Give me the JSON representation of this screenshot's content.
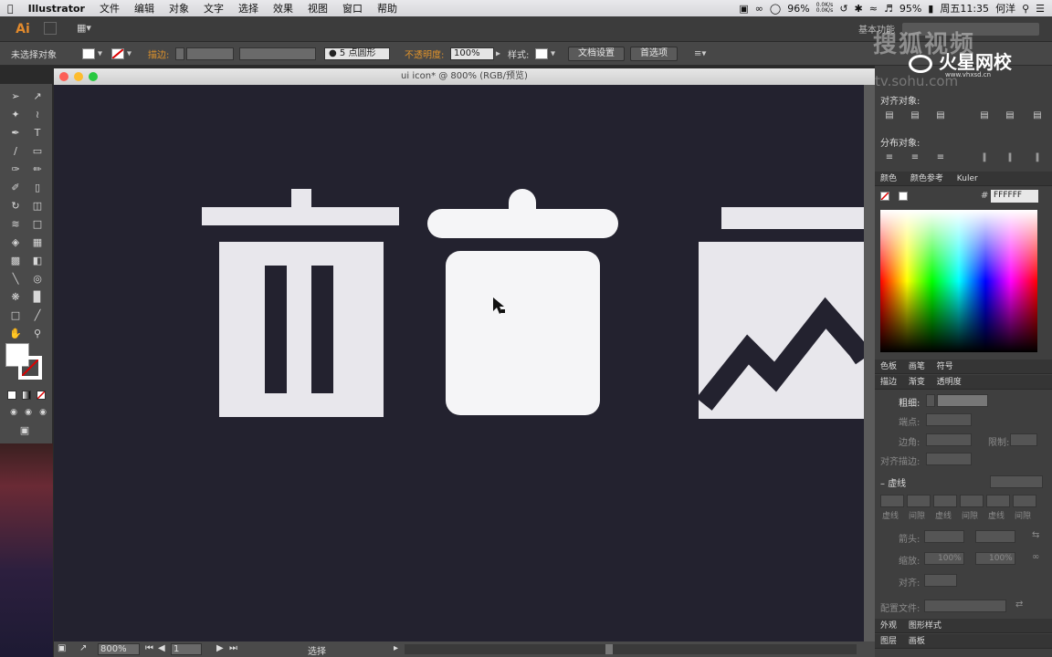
{
  "menubar": {
    "app_name": "Illustrator",
    "items": [
      "文件",
      "编辑",
      "对象",
      "文字",
      "选择",
      "效果",
      "视图",
      "窗口",
      "帮助"
    ],
    "battery_a": "96%",
    "net_up": "0.0K/s",
    "net_down": "0.0K/s",
    "battery_b": "95%",
    "clock": "周五11:35",
    "user": "何洋"
  },
  "appbar": {
    "logo": "Ai",
    "workspace": "基本功能"
  },
  "controlbar": {
    "selection_status": "未选择对象",
    "stroke_label": "描边:",
    "brush_label": "5 点圆形",
    "opacity_label": "不透明度:",
    "opacity_value": "100%",
    "style_label": "样式:",
    "doc_settings": "文档设置",
    "preferences": "首选项"
  },
  "document": {
    "title": "ui icon* @ 800% (RGB/预览)",
    "zoom": "800%",
    "artboard": "1",
    "status_tool": "选择"
  },
  "panels": {
    "align_objects": "对齐对象:",
    "distribute_objects": "分布对象:",
    "color_tab": "颜色",
    "color_guide_tab": "颜色参考",
    "kuler_tab": "Kuler",
    "hex_value": "FFFFFF",
    "swatches_tab": "色板",
    "brushes_tab": "画笔",
    "symbols_tab": "符号",
    "stroke_tab": "描边",
    "gradient_tab": "渐变",
    "transparency_tab": "透明度",
    "weight_label": "粗细:",
    "cap_label": "端点:",
    "corner_label": "边角:",
    "limit_label": "限制:",
    "align_stroke_label": "对齐描边:",
    "dashed_label": "虚线",
    "dash_labels": [
      "虚线",
      "间隙",
      "虚线",
      "间隙",
      "虚线",
      "间隙"
    ],
    "arrow_label": "箭头:",
    "scale_label": "缩放:",
    "scale_value": "100%",
    "align_label": "对齐:",
    "profile_label": "配置文件:",
    "appearance_tab": "外观",
    "graphic_styles_tab": "图形样式",
    "layers_tab": "图层",
    "artboards_tab": "画板"
  },
  "watermark": {
    "sohu": "搜狐视频",
    "site_cn": "火星网校",
    "url": "www.vhxsd.cn",
    "url_left": "tv.sohu.com"
  },
  "colors": {
    "canvas": "#23222f",
    "icon_fill": "#e8e7ec",
    "accent_orange": "#e0932b"
  }
}
